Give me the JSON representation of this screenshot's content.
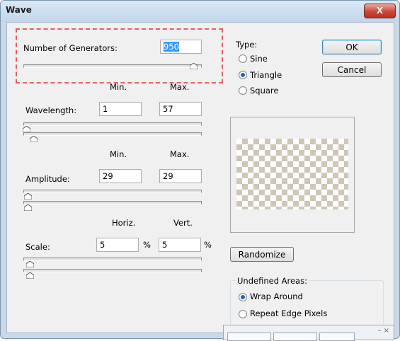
{
  "window": {
    "title": "Wave",
    "close_label": "X"
  },
  "generators": {
    "label": "Number of Generators:",
    "value": "950"
  },
  "wavelength": {
    "min_header": "Min.",
    "max_header": "Max.",
    "label": "Wavelength:",
    "min": "1",
    "max": "57"
  },
  "amplitude": {
    "min_header": "Min.",
    "max_header": "Max.",
    "label": "Amplitude:",
    "min": "29",
    "max": "29"
  },
  "scale": {
    "horiz_header": "Horiz.",
    "vert_header": "Vert.",
    "label": "Scale:",
    "horiz": "5",
    "vert": "5",
    "unit": "%"
  },
  "type": {
    "label": "Type:",
    "options": [
      "Sine",
      "Triangle",
      "Square"
    ],
    "selected": "Triangle"
  },
  "buttons": {
    "ok": "OK",
    "cancel": "Cancel",
    "randomize": "Randomize"
  },
  "undefined_areas": {
    "label": "Undefined Areas:",
    "options": [
      "Wrap Around",
      "Repeat Edge Pixels"
    ],
    "selected": "Wrap Around"
  },
  "overlay_panel": {
    "controls": "– ×"
  }
}
